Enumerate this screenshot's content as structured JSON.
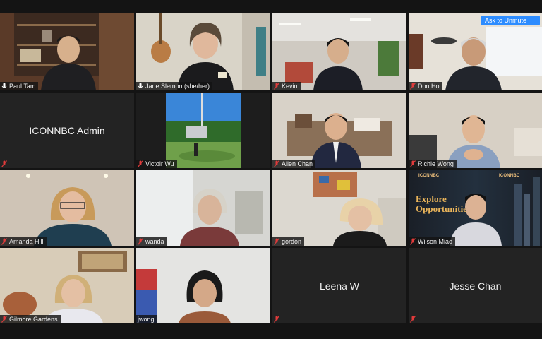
{
  "meeting": {
    "ask_to_unmute_label": "Ask to Unmute",
    "more_label": "···",
    "active_speaker_color": "#d6e04a",
    "accent_color": "#2d8cff"
  },
  "participants": [
    {
      "name": "Paul Tam",
      "muted": false,
      "video": true
    },
    {
      "name": "Jane Slemon (she/her)",
      "muted": false,
      "video": true,
      "active_speaker": true
    },
    {
      "name": "Kevin",
      "muted": true,
      "video": true
    },
    {
      "name": "Don Ho",
      "muted": true,
      "video": true
    },
    {
      "name": "ICONNBC Admin",
      "muted": true,
      "video": false
    },
    {
      "name": "Victoir Wu",
      "muted": true,
      "video": true
    },
    {
      "name": "Allen Chan",
      "muted": true,
      "video": true
    },
    {
      "name": "Richie Wong",
      "muted": true,
      "video": true
    },
    {
      "name": "Amanda Hill",
      "muted": true,
      "video": true
    },
    {
      "name": "wanda",
      "muted": true,
      "video": true
    },
    {
      "name": "gordon",
      "muted": true,
      "video": true
    },
    {
      "name": "Wilson Miao",
      "muted": true,
      "video": true
    },
    {
      "name": "Gilmore Gardens",
      "muted": true,
      "video": true
    },
    {
      "name": "jwong",
      "muted": true,
      "video": true
    },
    {
      "name": "Leena W",
      "muted": true,
      "video": false
    },
    {
      "name": "Jesse Chan",
      "muted": true,
      "video": false
    }
  ],
  "background_banner": {
    "logo_text": "ICONNBC",
    "headline": "Explore Opportunities"
  }
}
